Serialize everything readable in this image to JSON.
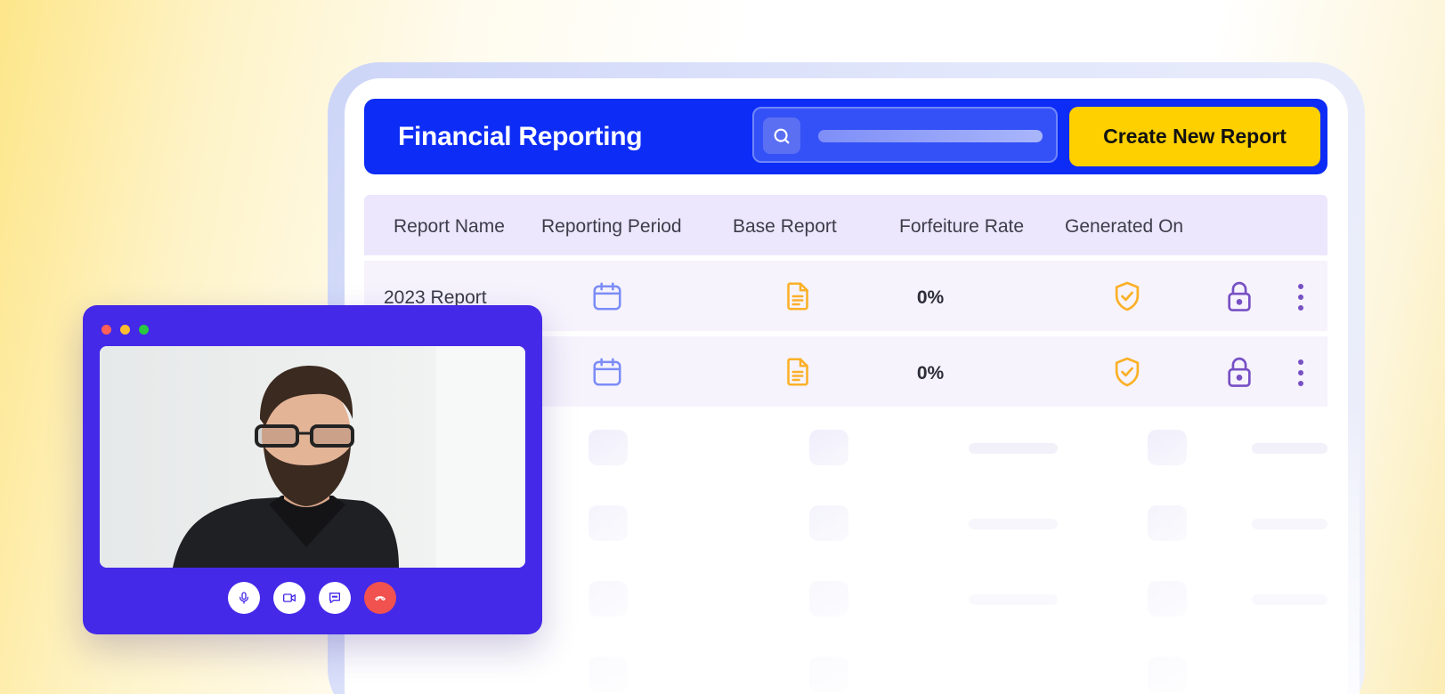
{
  "app": {
    "title": "Financial Reporting",
    "create_button_label": "Create New Report"
  },
  "search": {
    "icon": "search-icon"
  },
  "table": {
    "columns": [
      "Report Name",
      "Reporting Period",
      "Base Report",
      "Forfeiture Rate",
      "Generated On"
    ],
    "rows": [
      {
        "name": "2023 Report",
        "forfeiture_rate": "0%"
      },
      {
        "name": "",
        "forfeiture_rate": "0%"
      }
    ]
  },
  "video_call": {
    "window_dots": [
      "#ff5f57",
      "#febc2e",
      "#28c840"
    ],
    "controls": [
      "microphone-icon",
      "video-camera-icon",
      "chat-icon",
      "hang-up-icon"
    ]
  },
  "colors": {
    "brand_blue": "#0d2cf5",
    "accent_yellow": "#ffd000",
    "calendar_blue": "#7b8cf6",
    "document_orange": "#fbb026",
    "shield_orange": "#fbb026",
    "lock_purple": "#7750c4",
    "video_purple": "#4429e8",
    "hangup_red": "#f1524f"
  }
}
